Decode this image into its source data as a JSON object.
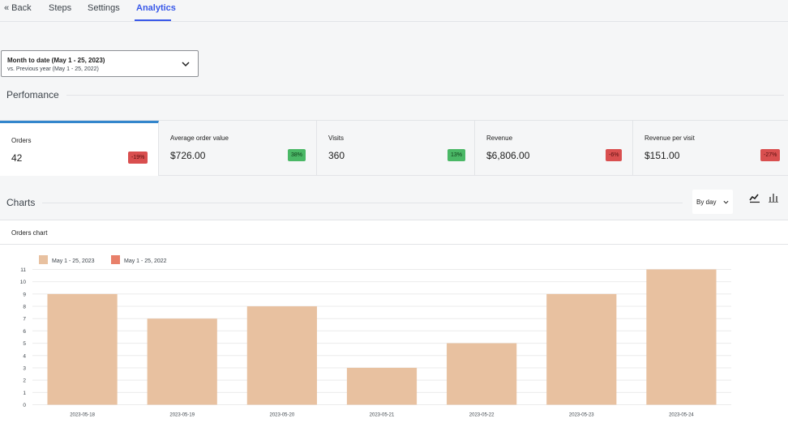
{
  "nav": {
    "back": "« Back",
    "tabs": [
      "Steps",
      "Settings",
      "Analytics"
    ],
    "active_tab": "Analytics"
  },
  "date_range": {
    "main": "Month to date (May 1 - 25, 2023)",
    "compare": "vs. Previous year (May 1 - 25, 2022)"
  },
  "performance": {
    "title": "Perfomance",
    "kpis": [
      {
        "label": "Orders",
        "value": "42",
        "delta": "-19%",
        "trend": "down"
      },
      {
        "label": "Average order value",
        "value": "$726.00",
        "delta": "38%",
        "trend": "up"
      },
      {
        "label": "Visits",
        "value": "360",
        "delta": "13%",
        "trend": "up"
      },
      {
        "label": "Revenue",
        "value": "$6,806.00",
        "delta": "-6%",
        "trend": "down"
      },
      {
        "label": "Revenue per visit",
        "value": "$151.00",
        "delta": "-27%",
        "trend": "down"
      }
    ]
  },
  "charts": {
    "title": "Charts",
    "interval": "By day",
    "chart_title": "Orders chart"
  },
  "chart_data": {
    "type": "bar",
    "title": "Orders chart",
    "categories": [
      "2023-05-18",
      "2023-05-19",
      "2023-05-20",
      "2023-05-21",
      "2023-05-22",
      "2023-05-23",
      "2023-05-24"
    ],
    "series": [
      {
        "name": "May 1 - 25, 2023",
        "color": "#e8c1a0",
        "values": [
          9,
          7,
          8,
          3,
          5,
          9,
          11
        ]
      },
      {
        "name": "May 1 - 25, 2022",
        "color": "#e8806a",
        "values": []
      }
    ],
    "y_ticks": [
      0,
      1,
      2,
      3,
      4,
      5,
      6,
      7,
      8,
      9,
      10,
      11
    ],
    "ylim": [
      0,
      11
    ],
    "legend": "top-left",
    "grid": true
  },
  "colors": {
    "accent": "#3858e9",
    "selected_border": "#3386cc",
    "badge_down": "#d94f4f",
    "badge_up": "#4ab866"
  }
}
